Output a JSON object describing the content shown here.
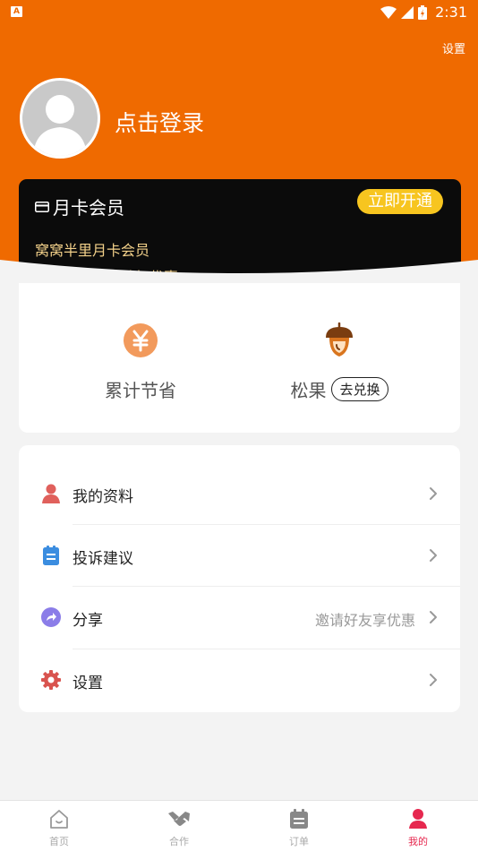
{
  "status_bar": {
    "left_badge": "A",
    "time": "2:31"
  },
  "header": {
    "settings_label": "设置",
    "login_label": "点击登录"
  },
  "vip_card": {
    "title": "月卡会员",
    "open_button": "立即开通",
    "subtitle": "窝窝半里月卡会员",
    "description": "尊享多重专属特权优惠"
  },
  "stats": {
    "savings": {
      "label": "累计节省",
      "icon": "yen-icon"
    },
    "pinecone": {
      "label": "松果",
      "icon": "acorn-icon",
      "redeem_label": "去兑换"
    }
  },
  "menu": {
    "items": [
      {
        "label": "我的资料",
        "value": "",
        "icon": "person-icon",
        "color": "#e0605c"
      },
      {
        "label": "投诉建议",
        "value": "",
        "icon": "clipboard-icon",
        "color": "#3b8de0"
      },
      {
        "label": "分享",
        "value": "邀请好友享优惠",
        "icon": "share-icon",
        "color": "#8b7de8"
      },
      {
        "label": "设置",
        "value": "",
        "icon": "gear-icon",
        "color": "#d9544f"
      }
    ]
  },
  "tab_bar": {
    "tabs": [
      {
        "label": "首页",
        "icon": "home-icon",
        "active": false
      },
      {
        "label": "合作",
        "icon": "handshake-icon",
        "active": false
      },
      {
        "label": "订单",
        "icon": "calendar-icon",
        "active": false
      },
      {
        "label": "我的",
        "icon": "profile-icon",
        "active": true
      }
    ]
  },
  "colors": {
    "brand": "#ef6a00",
    "gold": "#f7c51f",
    "active_tab": "#e6284f"
  }
}
